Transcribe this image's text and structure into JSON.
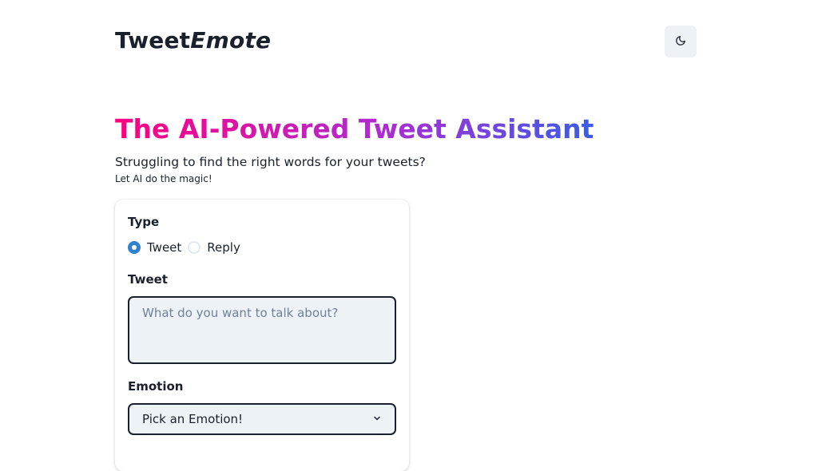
{
  "header": {
    "logo_part1": "Tweet",
    "logo_part2": "Emote",
    "theme_toggle_icon": "moon-icon"
  },
  "hero": {
    "title": "The AI-Powered Tweet Assistant",
    "subtitle": "Struggling to find the right words for your tweets?",
    "tagline": "Let AI do the magic!"
  },
  "form": {
    "type_label": "Type",
    "type_options": [
      {
        "label": "Tweet",
        "checked": true
      },
      {
        "label": "Reply",
        "checked": false
      }
    ],
    "tweet_label": "Tweet",
    "tweet_placeholder": "What do you want to talk about?",
    "emotion_label": "Emotion",
    "emotion_selected": "Pick an Emotion!"
  },
  "colors": {
    "gradient_start": "#ff0080",
    "gradient_mid": "#b02bd0",
    "gradient_end": "#3a5de8",
    "radio_accent": "#3182ce",
    "input_bg": "#edf2f7"
  }
}
